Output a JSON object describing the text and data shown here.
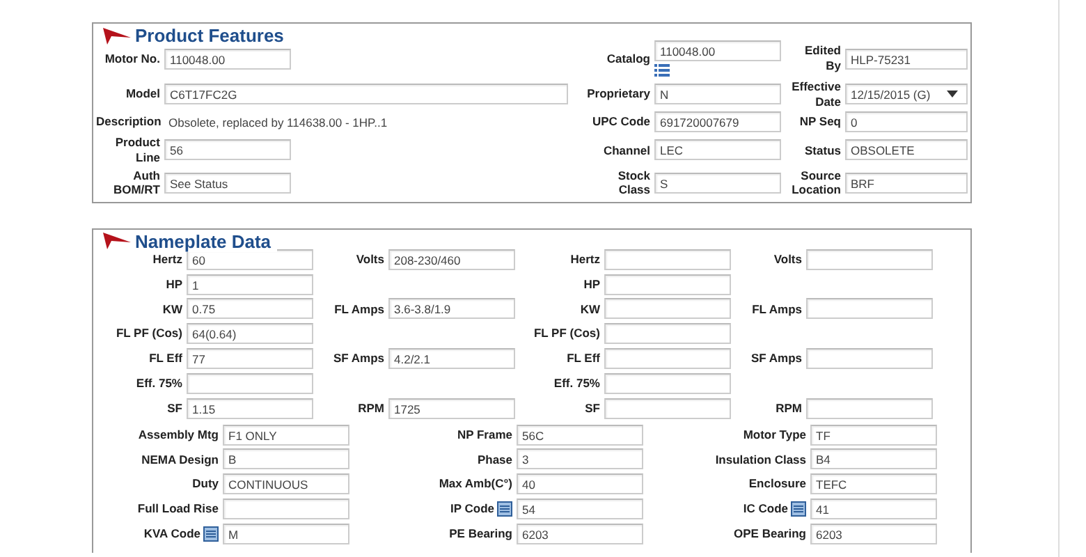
{
  "product_features": {
    "title": "Product Features",
    "rows": [
      {
        "left": {
          "label": "Motor No.",
          "value": "110048.00",
          "kind": "field"
        },
        "middle": {
          "label": "Catalog",
          "value": "110048.00",
          "kind": "list"
        },
        "right": {
          "label": "Edited\nBy",
          "value": "HLP-75231",
          "kind": "field"
        }
      },
      {
        "left": {
          "label": "Model",
          "value": "C6T17FC2G",
          "kind": "wide"
        },
        "middle": {
          "label": "Proprietary",
          "value": "N",
          "kind": "field"
        },
        "right": {
          "label": "Effective\nDate",
          "value": "12/15/2015 (G)",
          "kind": "dropdown"
        }
      },
      {
        "left": {
          "label": "Description",
          "value": "Obsolete, replaced by 114638.00 - 1HP..1",
          "kind": "text"
        },
        "middle": {
          "label": "UPC Code",
          "value": "691720007679",
          "kind": "field"
        },
        "right": {
          "label": "NP Seq",
          "value": "0",
          "kind": "field"
        }
      },
      {
        "left": {
          "label": "Product\nLine",
          "value": "56",
          "kind": "field"
        },
        "middle": {
          "label": "Channel",
          "value": "LEC",
          "kind": "field"
        },
        "right": {
          "label": "Status",
          "value": "OBSOLETE",
          "kind": "field"
        }
      },
      {
        "left": {
          "label": "Auth\nBOM/RT",
          "value": "See Status",
          "kind": "field"
        },
        "middle": {
          "label": "Stock\nClass",
          "value": "S",
          "kind": "field"
        },
        "right": {
          "label": "Source\nLocation",
          "value": "BRF",
          "kind": "field"
        }
      }
    ]
  },
  "nameplate_data": {
    "title": "Nameplate Data",
    "grid": [
      {
        "col_1": {
          "label": "Hertz",
          "value": "60"
        },
        "col_2": {
          "label": "Volts",
          "value": "208-230/460"
        },
        "col_3": {
          "label": "Hertz"
        },
        "col_4": {
          "label": "Volts"
        }
      },
      {
        "col_1": {
          "label": "HP",
          "value": "1"
        },
        "col_3": {
          "label": "HP"
        }
      },
      {
        "col_1": {
          "label": "KW",
          "value": "0.75"
        },
        "col_2": {
          "label": "FL Amps",
          "value": "3.6-3.8/1.9"
        },
        "col_3": {
          "label": "KW"
        },
        "col_4": {
          "label": "FL Amps"
        }
      },
      {
        "col_1": {
          "label": "FL PF (Cos)",
          "value": "64(0.64)"
        },
        "col_3": {
          "label": "FL PF (Cos)"
        }
      },
      {
        "col_1": {
          "label": "FL Eff",
          "value": "77"
        },
        "col_2": {
          "label": "SF Amps",
          "value": "4.2/2.1"
        },
        "col_3": {
          "label": "FL Eff"
        },
        "col_4": {
          "label": "SF Amps"
        }
      },
      {
        "col_1": {
          "label": "Eff. 75%"
        },
        "col_3": {
          "label": "Eff. 75%"
        }
      },
      {
        "col_1": {
          "label": "SF",
          "value": "1.15"
        },
        "col_2": {
          "label": "RPM",
          "value": "1725"
        },
        "col_3": {
          "label": "SF"
        },
        "col_4": {
          "label": "RPM"
        }
      }
    ],
    "details": [
      [
        {
          "label": "Assembly Mtg",
          "value": "F1 ONLY",
          "kind": "plain"
        },
        {
          "label": "NP Frame",
          "value": "56C",
          "kind": "plain"
        },
        {
          "label": "Motor Type",
          "value": "TF",
          "kind": "plain"
        }
      ],
      [
        {
          "label": "NEMA Design",
          "value": "B",
          "kind": "plain"
        },
        {
          "label": "Phase",
          "value": "3",
          "kind": "plain"
        },
        {
          "label": "Insulation Class",
          "value": "B4",
          "kind": "plain"
        }
      ],
      [
        {
          "label": "Duty",
          "value": "CONTINUOUS",
          "kind": "plain"
        },
        {
          "label": "Max Amb(C°)",
          "value": "40",
          "kind": "plain"
        },
        {
          "label": "Enclosure",
          "value": "TEFC",
          "kind": "plain"
        }
      ],
      [
        {
          "label": "Full Load Rise",
          "kind": "plain"
        },
        {
          "label": "IP Code",
          "value": "54",
          "kind": "note"
        },
        {
          "label": "IC Code",
          "value": "41",
          "kind": "note"
        }
      ],
      [
        {
          "label": "KVA Code",
          "value": "M",
          "kind": "note"
        },
        {
          "label": "PE Bearing",
          "value": "6203",
          "kind": "plain"
        },
        {
          "label": "OPE Bearing",
          "value": "6203",
          "kind": "plain"
        }
      ]
    ]
  }
}
